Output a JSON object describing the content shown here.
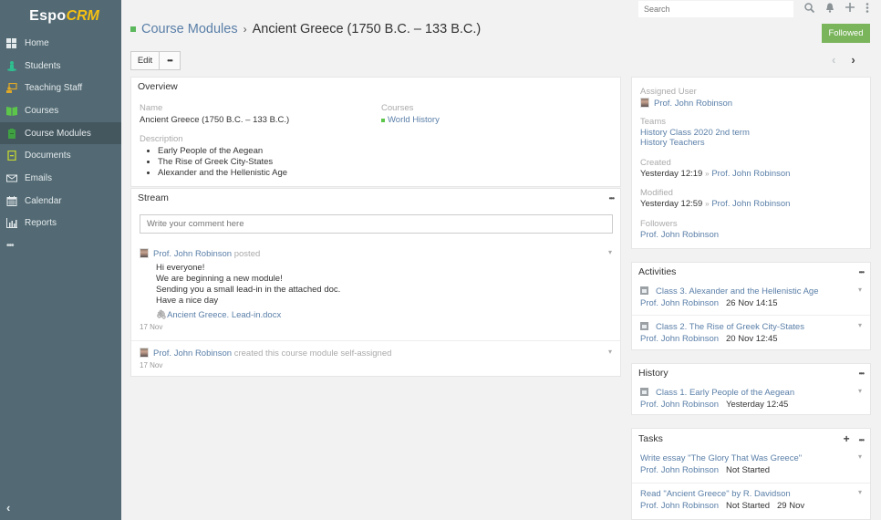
{
  "app": {
    "brand_main": "Espo",
    "brand_accent": "CRM"
  },
  "sidebar": {
    "items": [
      {
        "label": "Home",
        "icon": "grid-icon",
        "color": "#e4eaec"
      },
      {
        "label": "Students",
        "icon": "student-icon",
        "color": "#2fbf8f"
      },
      {
        "label": "Teaching Staff",
        "icon": "teacher-board-icon",
        "color": "#e0a828"
      },
      {
        "label": "Courses",
        "icon": "book-open-icon",
        "color": "#5cc64a"
      },
      {
        "label": "Course Modules",
        "icon": "clipboard-icon",
        "color": "#3fa142",
        "active": true
      },
      {
        "label": "Documents",
        "icon": "document-icon",
        "color": "#c4d631"
      },
      {
        "label": "Emails",
        "icon": "envelope-icon",
        "color": "#e4eaec"
      },
      {
        "label": "Calendar",
        "icon": "calendar-icon",
        "color": "#e4eaec"
      },
      {
        "label": "Reports",
        "icon": "bar-chart-icon",
        "color": "#e4eaec"
      }
    ],
    "more_label": "•••",
    "collapse_glyph": "‹"
  },
  "topbar": {
    "search_placeholder": "Search"
  },
  "header": {
    "breadcrumb_parent": "Course Modules",
    "separator": "›",
    "title": "Ancient Greece (1750 B.C. – 133 B.C.)",
    "followed_label": "Followed",
    "edit_label": "Edit",
    "more_label": "•••",
    "prev_glyph": "‹",
    "next_glyph": "›"
  },
  "overview": {
    "title": "Overview",
    "name_label": "Name",
    "name_value": "Ancient Greece (1750 B.C. – 133 B.C.)",
    "courses_label": "Courses",
    "courses_value": "World History",
    "description_label": "Description",
    "description_items": [
      "Early People of the Aegean",
      "The Rise of Greek City-States",
      "Alexander and the Hellenistic Age"
    ]
  },
  "stream": {
    "title": "Stream",
    "comment_placeholder": "Write your comment here",
    "notes": [
      {
        "author": "Prof. John Robinson",
        "action": "posted",
        "lines": [
          "Hi everyone!",
          "We are beginning a new module!",
          "Sending you a small lead-in in the attached doc.",
          "Have a nice day"
        ],
        "attachment": "Ancient Greece. Lead-in.docx",
        "time": "17 Nov"
      },
      {
        "author": "Prof. John Robinson",
        "action": "created this course module self-assigned",
        "time": "17 Nov"
      }
    ]
  },
  "side": {
    "assigned_user_label": "Assigned User",
    "assigned_user": "Prof. John Robinson",
    "teams_label": "Teams",
    "teams": [
      "History Class 2020 2nd term",
      "History Teachers"
    ],
    "created_label": "Created",
    "created_time": "Yesterday 12:19",
    "created_by": "Prof. John Robinson",
    "modified_label": "Modified",
    "modified_time": "Yesterday 12:59",
    "modified_by": "Prof. John Robinson",
    "followers_label": "Followers",
    "followers": "Prof. John Robinson",
    "by_sep": "»"
  },
  "activities": {
    "title": "Activities",
    "items": [
      {
        "name": "Class 3. Alexander and the Hellenistic Age",
        "user": "Prof. John Robinson",
        "date": "26 Nov 14:15"
      },
      {
        "name": "Class 2. The Rise of Greek City-States",
        "user": "Prof. John Robinson",
        "date": "20 Nov 12:45"
      }
    ]
  },
  "history": {
    "title": "History",
    "items": [
      {
        "name": "Class 1. Early People of the Aegean",
        "user": "Prof. John Robinson",
        "date": "Yesterday 12:45"
      }
    ]
  },
  "tasks": {
    "title": "Tasks",
    "add_glyph": "+",
    "items": [
      {
        "name": "Write essay \"The Glory That Was Greece\"",
        "user": "Prof. John Robinson",
        "status": "Not Started",
        "date": ""
      },
      {
        "name": "Read \"Ancient Greece\" by R. Davidson",
        "user": "Prof. John Robinson",
        "status": "Not Started",
        "date": "29 Nov"
      }
    ]
  },
  "colors": {
    "accent": "#5a7fa8",
    "sidebar_bg": "#536a74",
    "followed_bg": "#7ab55c",
    "module_green": "#5cb85c"
  }
}
